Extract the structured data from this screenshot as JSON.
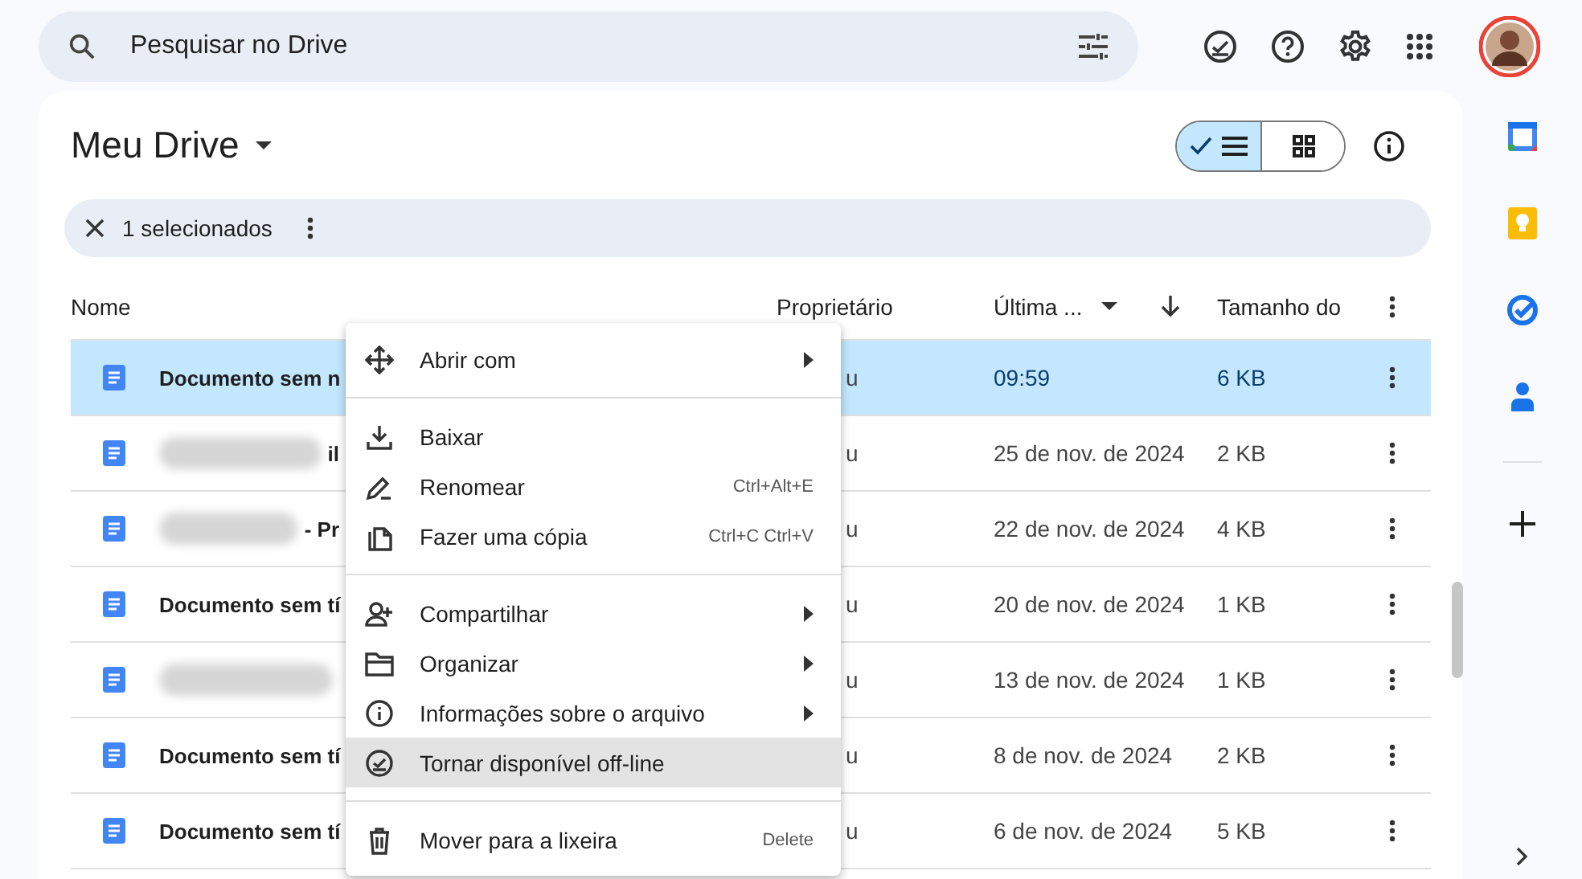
{
  "search": {
    "placeholder": "Pesquisar no Drive"
  },
  "title": "Meu Drive",
  "view_toggle": [
    {
      "kind": "list",
      "selected": true
    },
    {
      "kind": "grid",
      "selected": false
    }
  ],
  "selection_bar": {
    "count": "1 selecionados"
  },
  "table": {
    "columns": [
      {
        "label": "Nome",
        "kind": "plain"
      },
      {
        "label": "Proprietário",
        "kind": "plain"
      },
      {
        "label": "Última ...",
        "kind": "sort"
      },
      {
        "label": "Tamanho do",
        "kind": "plain"
      }
    ],
    "rows": [
      {
        "name": "Documento sem n",
        "blurred": false,
        "owner": "u",
        "modified": "09:59",
        "size": "6 KB",
        "selected": true
      },
      {
        "name": "il",
        "blurred": true,
        "owner": "u",
        "modified": "25 de nov. de 2024",
        "size": "2 KB",
        "selected": false
      },
      {
        "name": "- Pr",
        "blurred": true,
        "owner": "u",
        "modified": "22 de nov. de 2024",
        "size": "4 KB",
        "selected": false
      },
      {
        "name": "Documento sem tí",
        "blurred": false,
        "owner": "u",
        "modified": "20 de nov. de 2024",
        "size": "1 KB",
        "selected": false
      },
      {
        "blurred": true,
        "owner": "u",
        "modified": "13 de nov. de 2024",
        "size": "1 KB",
        "selected": false
      },
      {
        "name": "Documento sem tí",
        "blurred": false,
        "owner": "u",
        "modified": "8 de nov. de 2024",
        "size": "2 KB",
        "selected": false
      },
      {
        "name": "Documento sem tí",
        "blurred": false,
        "owner": "u",
        "modified": "6 de nov. de 2024",
        "size": "5 KB",
        "selected": false
      }
    ]
  },
  "context_menu": [
    {
      "kind": "item",
      "label": "Abrir com",
      "submenu": true,
      "highlighted": false
    },
    {
      "kind": "divider"
    },
    {
      "kind": "item",
      "label": "Baixar",
      "submenu": false,
      "highlighted": false
    },
    {
      "kind": "item",
      "label": "Renomear",
      "shortcut": "Ctrl+Alt+E",
      "submenu": false,
      "highlighted": false
    },
    {
      "kind": "item",
      "label": "Fazer uma cópia",
      "shortcut": "Ctrl+C Ctrl+V",
      "submenu": false,
      "highlighted": false
    },
    {
      "kind": "divider"
    },
    {
      "kind": "item",
      "label": "Compartilhar",
      "submenu": true,
      "highlighted": false
    },
    {
      "kind": "item",
      "label": "Organizar",
      "submenu": true,
      "highlighted": false
    },
    {
      "kind": "item",
      "label": "Informações sobre o arquivo",
      "submenu": true,
      "highlighted": false
    },
    {
      "kind": "item",
      "label": "Tornar disponível off-line",
      "submenu": false,
      "highlighted": true
    },
    {
      "kind": "divider"
    },
    {
      "kind": "item",
      "label": "Mover para a lixeira",
      "shortcut": "Delete",
      "submenu": false,
      "highlighted": false
    }
  ]
}
